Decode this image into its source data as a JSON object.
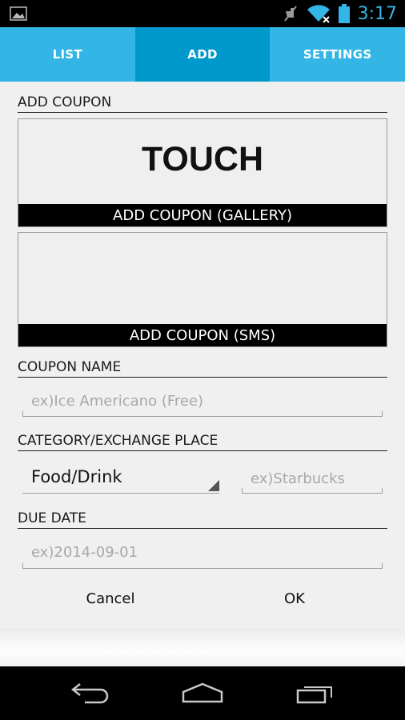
{
  "status_bar": {
    "time": "3:17",
    "icons": [
      "image-icon",
      "mute-icon",
      "wifi-icon",
      "battery-icon"
    ]
  },
  "tabs": [
    {
      "label": "LIST",
      "active": false
    },
    {
      "label": "ADD",
      "active": true
    },
    {
      "label": "SETTINGS",
      "active": false
    }
  ],
  "add_coupon": {
    "header": "ADD COUPON",
    "gallery": {
      "touch_text": "TOUCH",
      "label": "ADD COUPON (GALLERY)"
    },
    "sms": {
      "label": "ADD COUPON (SMS)"
    }
  },
  "coupon_name": {
    "header": "COUPON NAME",
    "placeholder": "ex)Ice Americano (Free)"
  },
  "category": {
    "header": "CATEGORY/EXCHANGE PLACE",
    "selected": "Food/Drink",
    "place_placeholder": "ex)Starbucks"
  },
  "due_date": {
    "header": "DUE DATE",
    "placeholder": "ex)2014-09-01"
  },
  "actions": {
    "cancel": "Cancel",
    "ok": "OK"
  },
  "colors": {
    "accent": "#33b5e5",
    "tab_active": "#0099cc",
    "time": "#33b5e5"
  }
}
